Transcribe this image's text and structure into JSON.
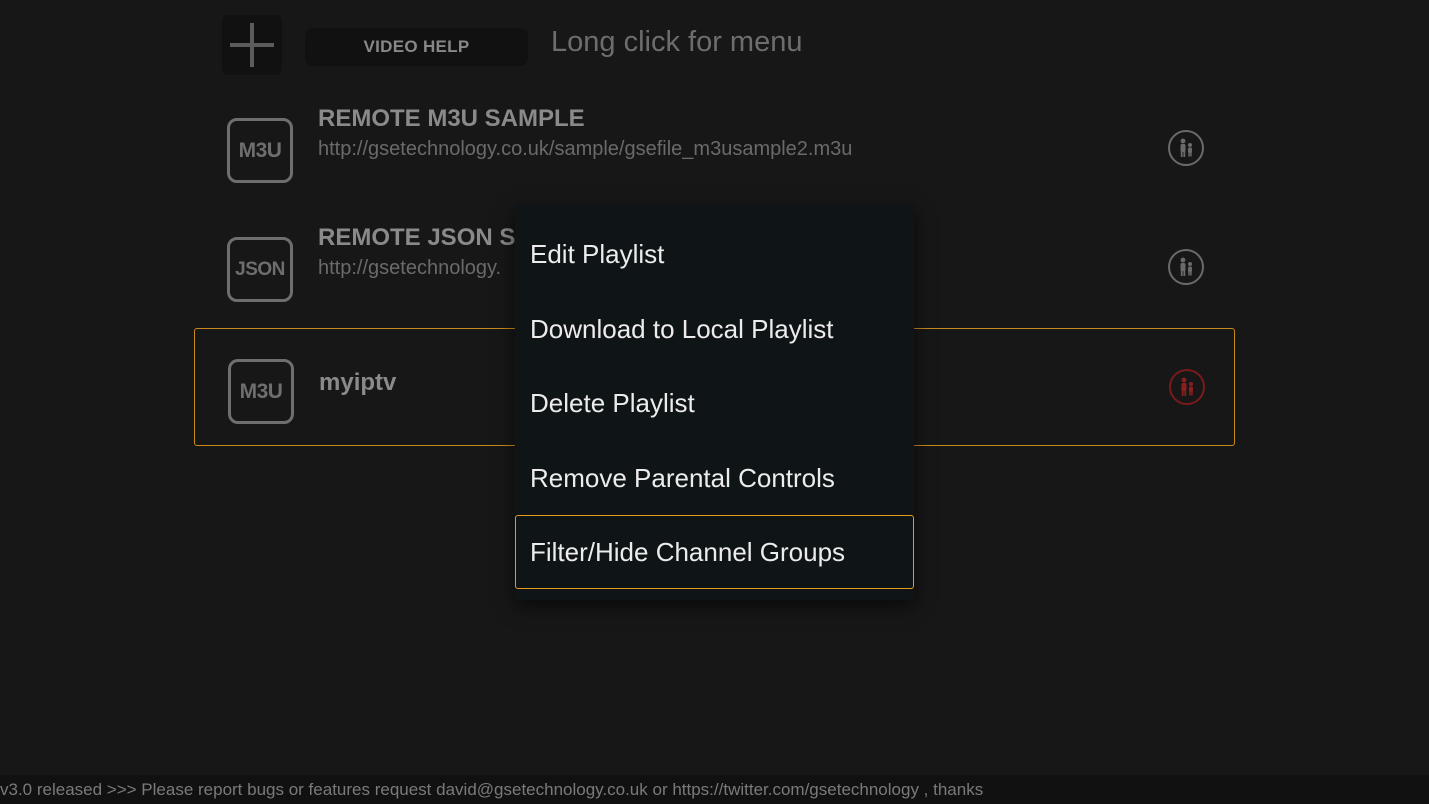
{
  "header": {
    "add_icon": "plus-icon",
    "video_help_label": "VIDEO HELP",
    "hint": "Long click for menu"
  },
  "playlists": [
    {
      "badge": "M3U",
      "title": "REMOTE M3U SAMPLE",
      "url": "http://gsetechnology.co.uk/sample/gsefile_m3usample2.m3u",
      "parental_icon": "family-icon",
      "parental_active": false
    },
    {
      "badge": "JSON",
      "title": "REMOTE JSON SA",
      "url": "http://gsetechnology.",
      "parental_icon": "family-icon",
      "parental_active": false
    },
    {
      "badge": "M3U",
      "title": "myiptv",
      "url": "",
      "parental_icon": "family-icon",
      "parental_active": true,
      "selected": true
    }
  ],
  "context_menu": {
    "items": [
      {
        "label": "Edit Playlist"
      },
      {
        "label": "Download to Local Playlist"
      },
      {
        "label": "Delete Playlist"
      },
      {
        "label": "Remove Parental Controls"
      },
      {
        "label": "Filter/Hide Channel Groups",
        "focused": true
      }
    ]
  },
  "ticker": {
    "text": "v3.0 released >>>  Please report bugs or features request david@gsetechnology.co.uk or https://twitter.com/gsetechnology , thanks"
  },
  "colors": {
    "background": "#171717",
    "focus_border": "#e39b1c",
    "selected_row_border": "#c98a1c",
    "parental_active": "#8b1e1e",
    "menu_background": "#0f1416"
  }
}
